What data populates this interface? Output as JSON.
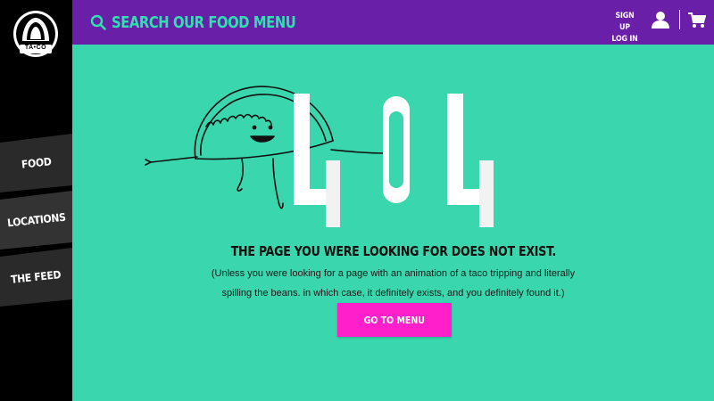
{
  "brand": {
    "logo_text": "TA•CO"
  },
  "sidebar": {
    "items": [
      {
        "label": "FOOD"
      },
      {
        "label": "LOCATIONS"
      },
      {
        "label": "THE FEED"
      }
    ]
  },
  "header": {
    "search_placeholder": "SEARCH OUR FOOD MENU",
    "sign_up": "SIGN UP",
    "log_in": "LOG IN",
    "user_icon": "user-icon",
    "cart_icon": "cart-icon"
  },
  "error": {
    "code": "404",
    "headline": "THE PAGE YOU WERE LOOKING FOR DOES NOT EXIST.",
    "subtext_line1": "(Unless you were looking for a page with an animation of a taco tripping and literally",
    "subtext_line2": "spilling the beans. in which case, it definitely exists, and you definitely found it.)",
    "button_label": "GO TO MENU"
  },
  "colors": {
    "topbar": "#6a1fa8",
    "main_bg": "#3ad6ad",
    "accent_search": "#2fe0b0",
    "button": "#ff1fcb",
    "sidebar": "#000000",
    "nav_tile_1": "#2a2a2a",
    "nav_tile_2": "#333333",
    "nav_tile_3": "#2a2a2a"
  }
}
